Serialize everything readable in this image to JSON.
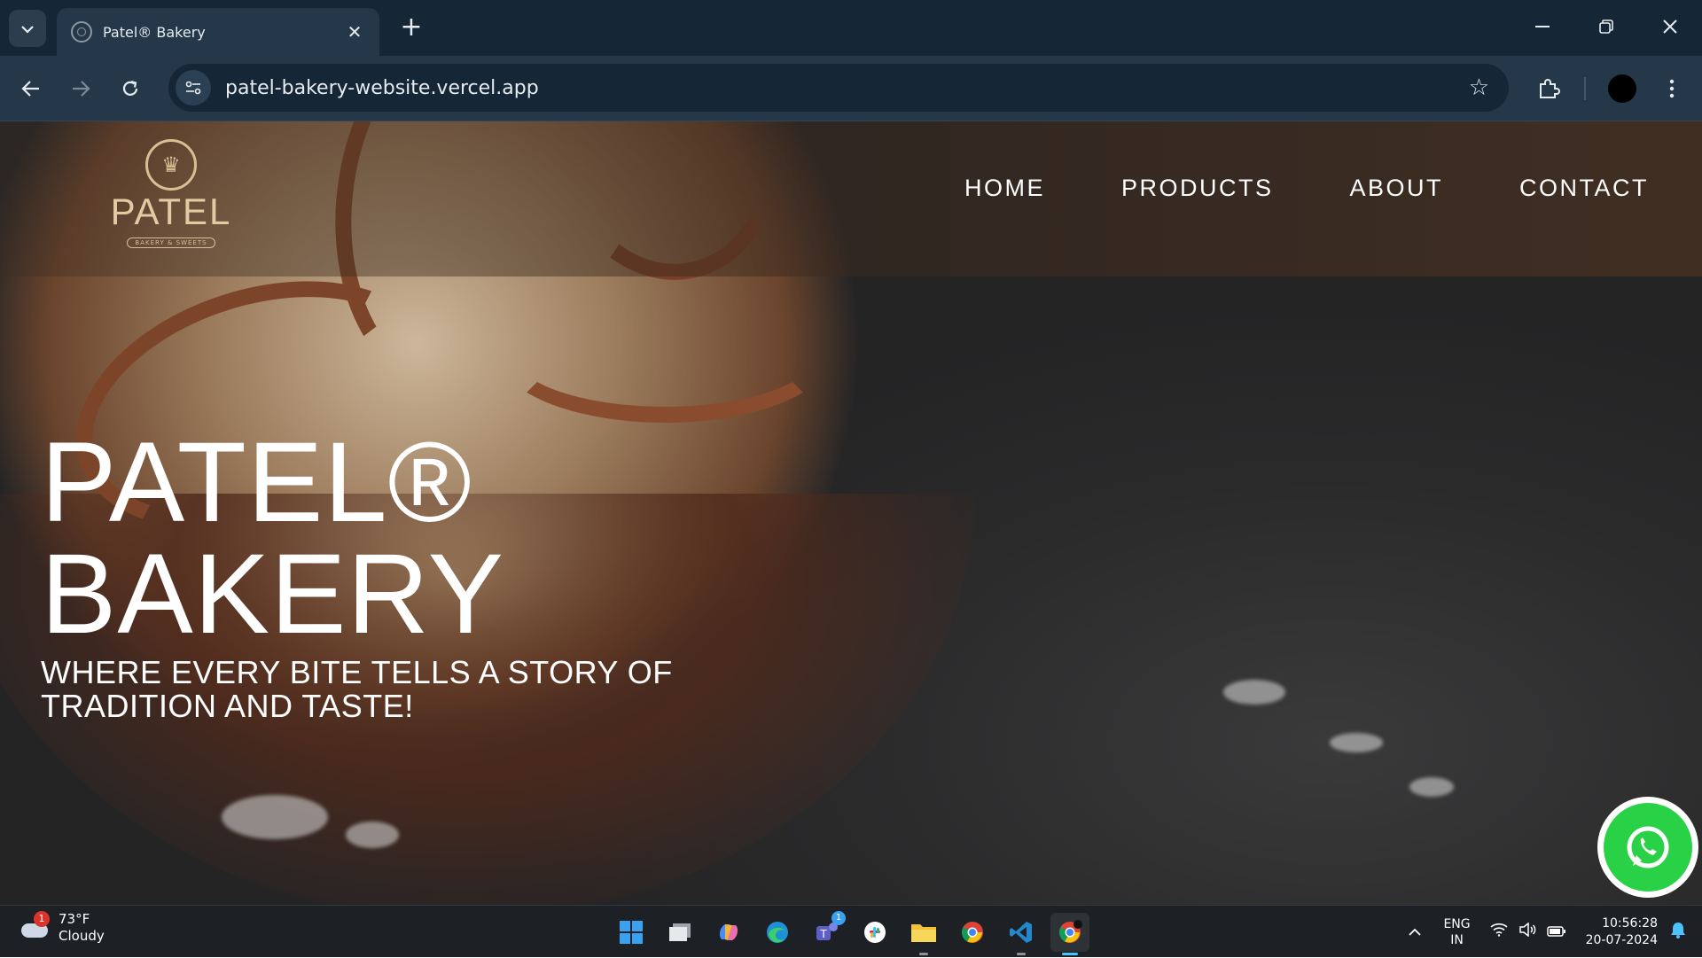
{
  "browser": {
    "tab_title": "Patel® Bakery",
    "url": "patel-bakery-website.vercel.app"
  },
  "site": {
    "logo_text": "PATEL",
    "logo_tagline": "BAKERY & SWEETS",
    "nav": [
      "HOME",
      "PRODUCTS",
      "ABOUT",
      "CONTACT"
    ],
    "hero_title_line1": "PATEL®",
    "hero_title_line2": "BAKERY",
    "hero_subtitle": "WHERE EVERY BITE TELLS A STORY OF TRADITION AND TASTE!"
  },
  "taskbar": {
    "weather_temp": "73°F",
    "weather_desc": "Cloudy",
    "weather_badge": "1",
    "lang_line1": "ENG",
    "lang_line2": "IN",
    "time": "10:56:28",
    "date": "20-07-2024",
    "teams_badge": "1"
  },
  "colors": {
    "chrome_dark": "#152636",
    "chrome_toolbar": "#24384a",
    "logo_gold": "#d9bf94",
    "whatsapp_green": "#28d146"
  }
}
